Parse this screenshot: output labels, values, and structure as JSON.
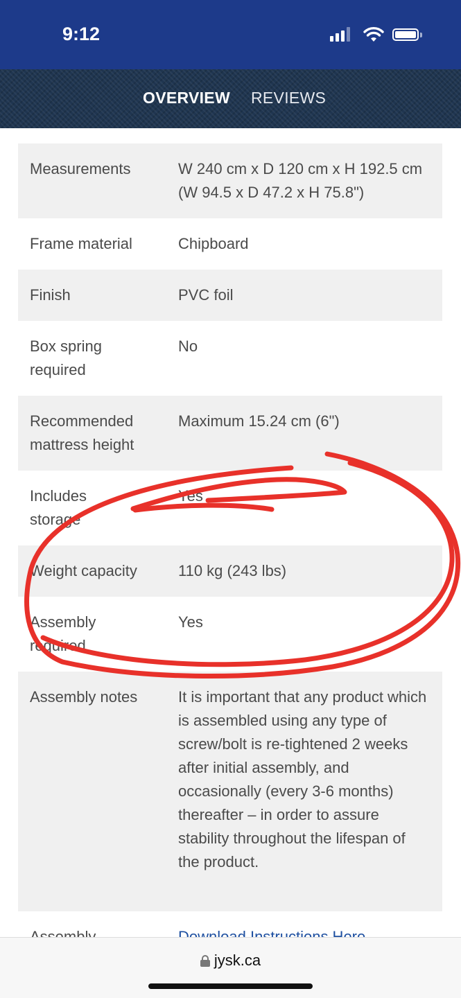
{
  "status_bar": {
    "time": "9:12"
  },
  "tabs": [
    {
      "label": "OVERVIEW",
      "active": true
    },
    {
      "label": "REVIEWS",
      "active": false
    }
  ],
  "specs": [
    {
      "label": "Measurements",
      "value": "W 240 cm x D 120 cm x H 192.5 cm (W 94.5 x D 47.2 x H 75.8\")"
    },
    {
      "label": "Frame material",
      "value": "Chipboard"
    },
    {
      "label": "Finish",
      "value": "PVC foil"
    },
    {
      "label": "Box spring required",
      "value": "No"
    },
    {
      "label": "Recommended mattress height",
      "value": "Maximum 15.24 cm (6\")"
    },
    {
      "label": "Includes storage",
      "value": "Yes"
    },
    {
      "label": "Weight capacity",
      "value": "110 kg (243 lbs)"
    },
    {
      "label": "Assembly required",
      "value": "Yes"
    },
    {
      "label": "Assembly notes",
      "value": "It is important that any product which is assembled using any type of screw/bolt is re-tightened 2 weeks after initial assembly, and occasionally (every 3-6 months) thereafter – in order to assure stability throughout the lifespan of the product."
    },
    {
      "label": "Assembly",
      "value": "Download Instructions Here"
    }
  ],
  "browser": {
    "url": "jysk.ca"
  },
  "colors": {
    "header": "#1d3a8a",
    "annotation": "#e8312a",
    "link": "#1d4fa0"
  }
}
